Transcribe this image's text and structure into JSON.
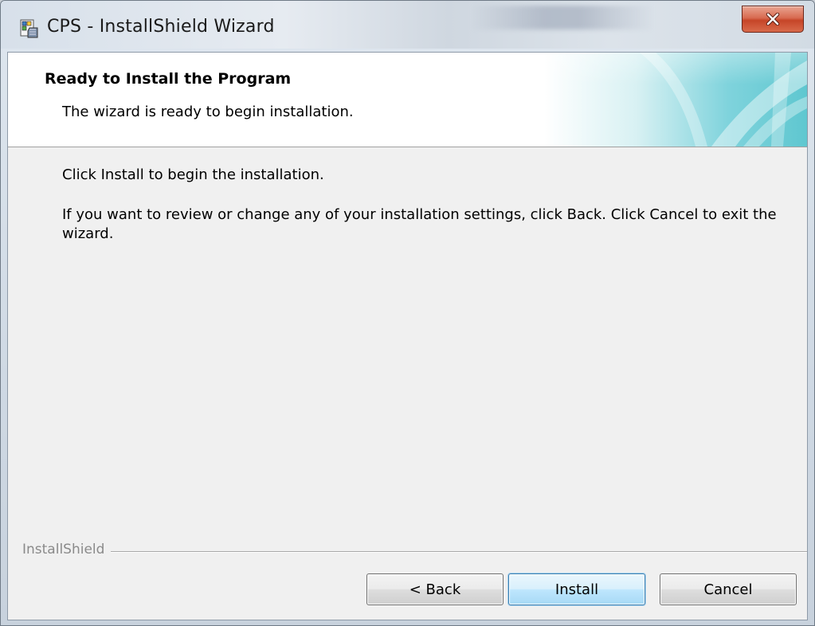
{
  "window": {
    "title": "CPS - InstallShield Wizard",
    "close_label": "x"
  },
  "header": {
    "title": "Ready to Install the Program",
    "subtitle": "The wizard is ready to begin installation."
  },
  "body": {
    "line1": "Click Install to begin the installation.",
    "line2": "If you want to review or change any of your installation settings, click Back. Click Cancel to exit the wizard."
  },
  "footer": {
    "brand": "InstallShield",
    "buttons": {
      "back": "< Back",
      "install": "Install",
      "cancel": "Cancel"
    }
  },
  "icons": {
    "app": "installer-icon",
    "close": "close-icon"
  },
  "colors": {
    "client_bg": "#f0f0f0",
    "close_button": "#c64528",
    "default_button_border": "#3c7fb1",
    "header_accent": "#5fc7d0"
  }
}
